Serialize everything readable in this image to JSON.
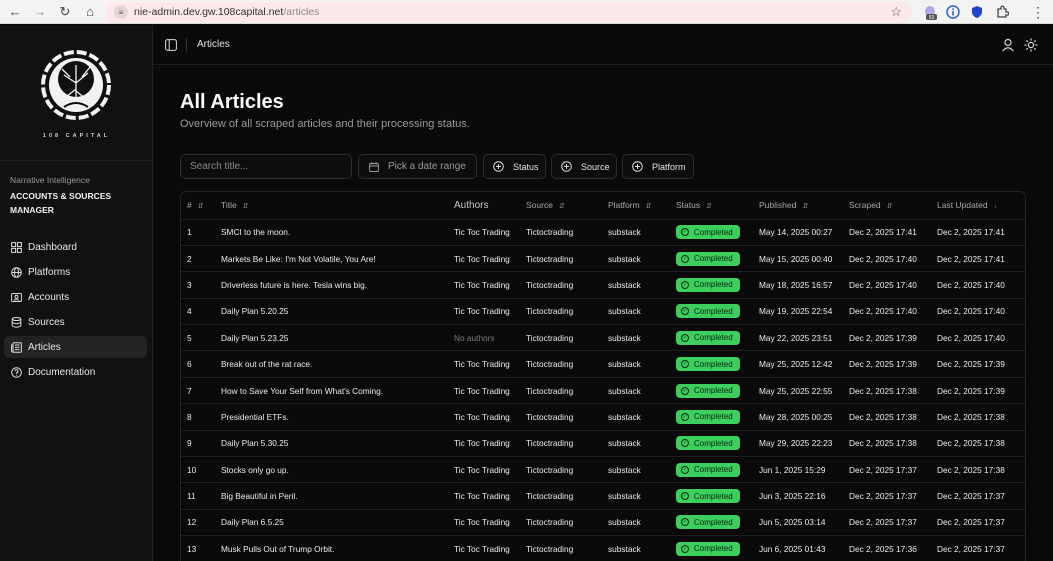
{
  "browser": {
    "url_host": "nie-admin.dev.gw.108capital.net",
    "url_path": "/articles",
    "ext_badge": "53"
  },
  "sidebar": {
    "brand": "108 CAPITAL",
    "app_label": "Narrative Intelligence",
    "app_title": "ACCOUNTS & SOURCES MANAGER",
    "items": [
      {
        "label": "Dashboard",
        "icon": "dashboard-icon"
      },
      {
        "label": "Platforms",
        "icon": "globe-icon"
      },
      {
        "label": "Accounts",
        "icon": "id-card-icon"
      },
      {
        "label": "Sources",
        "icon": "database-icon"
      },
      {
        "label": "Articles",
        "icon": "newspaper-icon",
        "active": true
      },
      {
        "label": "Documentation",
        "icon": "help-circle-icon"
      }
    ]
  },
  "topbar": {
    "breadcrumb": "Articles"
  },
  "page": {
    "title": "All Articles",
    "subtitle": "Overview of all scraped articles and their processing status."
  },
  "filters": {
    "search_placeholder": "Search title...",
    "date_label": "Pick a date range",
    "status_label": "Status",
    "source_label": "Source",
    "platform_label": "Platform"
  },
  "table": {
    "headers": [
      "#",
      "Title",
      "Authors",
      "Source",
      "Platform",
      "Status",
      "Published",
      "Scraped",
      "Last Updated"
    ],
    "rows": [
      [
        "1",
        "SMCI to the moon.",
        "Tic Toc Trading",
        "Tictoctrading",
        "substack",
        "Completed",
        "May 14, 2025 00:27",
        "Dec 2, 2025 17:41",
        "Dec 2, 2025 17:41"
      ],
      [
        "2",
        "Markets Be Like: I'm Not Volatile, You Are!",
        "Tic Toc Trading",
        "Tictoctrading",
        "substack",
        "Completed",
        "May 15, 2025 00:40",
        "Dec 2, 2025 17:40",
        "Dec 2, 2025 17:41"
      ],
      [
        "3",
        "Driverless future is here. Tesla wins big.",
        "Tic Toc Trading",
        "Tictoctrading",
        "substack",
        "Completed",
        "May 18, 2025 16:57",
        "Dec 2, 2025 17:40",
        "Dec 2, 2025 17:40"
      ],
      [
        "4",
        "Daily Plan 5.20.25",
        "Tic Toc Trading",
        "Tictoctrading",
        "substack",
        "Completed",
        "May 19, 2025 22:54",
        "Dec 2, 2025 17:40",
        "Dec 2, 2025 17:40"
      ],
      [
        "5",
        "Daily Plan 5.23.25",
        "No authors",
        "Tictoctrading",
        "substack",
        "Completed",
        "May 22, 2025 23:51",
        "Dec 2, 2025 17:39",
        "Dec 2, 2025 17:40"
      ],
      [
        "6",
        "Break out of the rat race.",
        "Tic Toc Trading",
        "Tictoctrading",
        "substack",
        "Completed",
        "May 25, 2025 12:42",
        "Dec 2, 2025 17:39",
        "Dec 2, 2025 17:39"
      ],
      [
        "7",
        "How to Save Your Self from What's Coming.",
        "Tic Toc Trading",
        "Tictoctrading",
        "substack",
        "Completed",
        "May 25, 2025 22:55",
        "Dec 2, 2025 17:38",
        "Dec 2, 2025 17:39"
      ],
      [
        "8",
        "Presidential ETFs.",
        "Tic Toc Trading",
        "Tictoctrading",
        "substack",
        "Completed",
        "May 28, 2025 00:25",
        "Dec 2, 2025 17:38",
        "Dec 2, 2025 17:38"
      ],
      [
        "9",
        "Daily Plan 5.30.25",
        "Tic Toc Trading",
        "Tictoctrading",
        "substack",
        "Completed",
        "May 29, 2025 22:23",
        "Dec 2, 2025 17:38",
        "Dec 2, 2025 17:38"
      ],
      [
        "10",
        "Stocks only go up.",
        "Tic Toc Trading",
        "Tictoctrading",
        "substack",
        "Completed",
        "Jun 1, 2025 15:29",
        "Dec 2, 2025 17:37",
        "Dec 2, 2025 17:38"
      ],
      [
        "11",
        "Big Beautiful in Peril.",
        "Tic Toc Trading",
        "Tictoctrading",
        "substack",
        "Completed",
        "Jun 3, 2025 22:16",
        "Dec 2, 2025 17:37",
        "Dec 2, 2025 17:37"
      ],
      [
        "12",
        "Daily Plan 6.5.25",
        "Tic Toc Trading",
        "Tictoctrading",
        "substack",
        "Completed",
        "Jun 5, 2025 03:14",
        "Dec 2, 2025 17:37",
        "Dec 2, 2025 17:37"
      ],
      [
        "13",
        "Musk Pulls Out of Trump Orbit.",
        "Tic Toc Trading",
        "Tictoctrading",
        "substack",
        "Completed",
        "Jun 6, 2025 01:43",
        "Dec 2, 2025 17:36",
        "Dec 2, 2025 17:37"
      ]
    ]
  },
  "colors": {
    "status_completed": "#3ccf5e",
    "background": "#0a0a0a",
    "sidebar": "#111112"
  }
}
